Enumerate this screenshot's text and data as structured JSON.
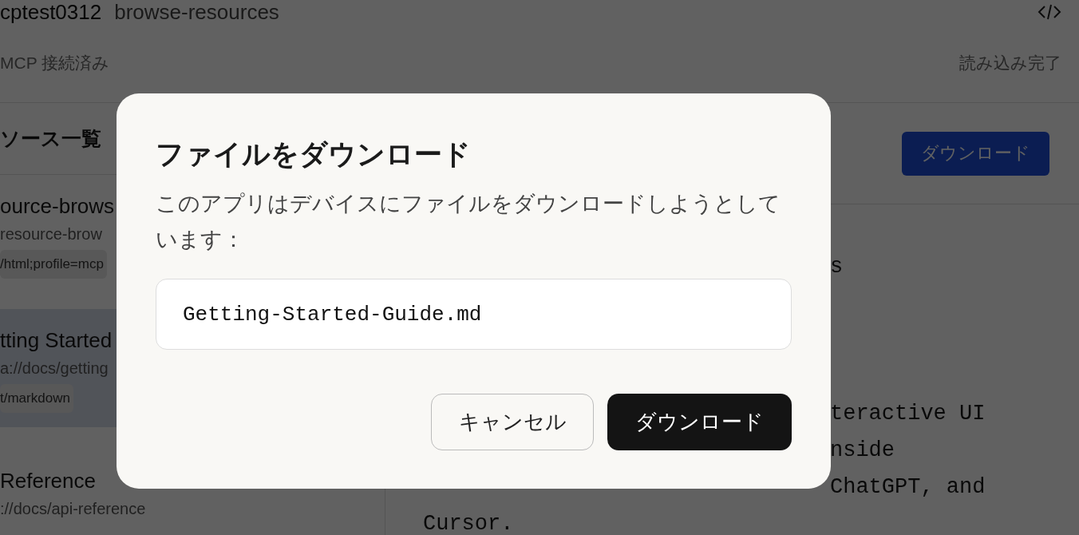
{
  "app": {
    "title": "cptest0312",
    "subtitle": "browse-resources",
    "status_left": "MCP 接続済み",
    "status_right": "読み込み完了",
    "sidebar": {
      "heading": "ソース一覧",
      "items": [
        {
          "title": "ource-brows",
          "uri": "resource-brow",
          "mime": "/html;profile=mcp",
          "selected": false
        },
        {
          "title": "tting Started",
          "uri": "a://docs/getting",
          "mime": "t/markdown",
          "selected": true
        },
        {
          "title": "Reference",
          "uri": "://docs/api-reference",
          "selected": false
        }
      ]
    },
    "download_button": "ダウンロード",
    "content_lines": [
      {
        "text": "s",
        "kind": "fragment"
      },
      {
        "text": "teractive UI",
        "kind": "fragment-para"
      },
      {
        "text": "nside",
        "kind": "fragment"
      },
      {
        "text": "ChatGPT, and",
        "kind": "fragment"
      },
      {
        "text": "Cursor.",
        "kind": "full"
      }
    ]
  },
  "dialog": {
    "title": "ファイルをダウンロード",
    "message": "このアプリはデバイスにファイルをダウンロードしようとしています：",
    "filename": "Getting-Started-Guide.md",
    "buttons": [
      {
        "label": "キャンセル",
        "kind": "secondary"
      },
      {
        "label": "ダウンロード",
        "kind": "primary"
      }
    ]
  }
}
